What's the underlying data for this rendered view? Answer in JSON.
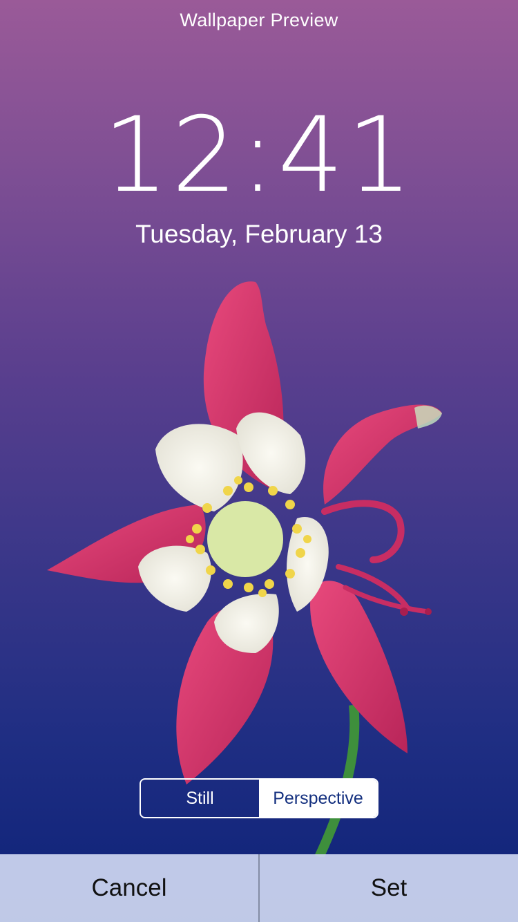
{
  "header": {
    "title": "Wallpaper Preview"
  },
  "lockscreen": {
    "time": "12:41",
    "date": "Tuesday, February 13"
  },
  "wallpaper": {
    "subject": "columbine-flower-icon",
    "colors": {
      "top": "#9a5a98",
      "bottom": "#0d2278",
      "petal": "#d43a6e",
      "inner_petal": "#f2efe6",
      "stamen": "#f0d54a",
      "stem": "#3e8f3c"
    }
  },
  "mode_toggle": {
    "options": [
      "Still",
      "Perspective"
    ],
    "selected": "Perspective"
  },
  "actions": {
    "cancel_label": "Cancel",
    "set_label": "Set"
  }
}
